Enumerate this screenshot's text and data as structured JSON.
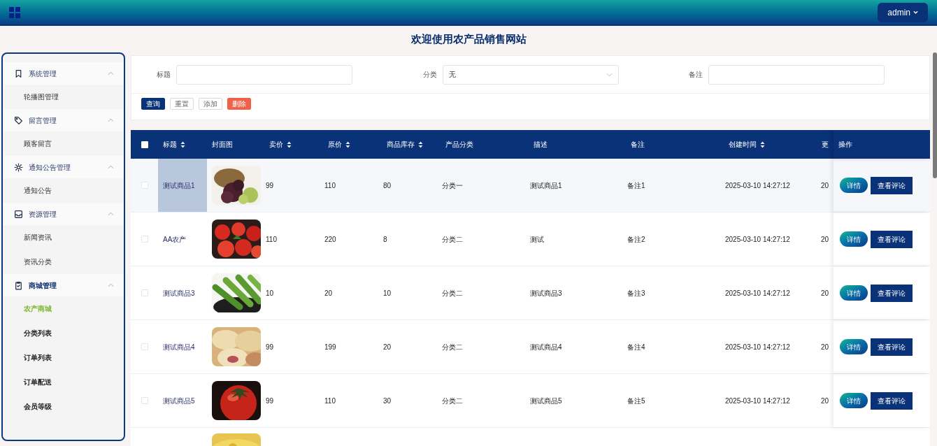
{
  "header": {
    "user_menu": "admin"
  },
  "page_title": "欢迎使用农产品销售网站",
  "sidebar": {
    "groups": [
      {
        "label": "系统管理",
        "expanded": true,
        "active": false,
        "items": [
          {
            "label": "轮播图管理",
            "selected": false
          }
        ]
      },
      {
        "label": "留言管理",
        "expanded": true,
        "active": false,
        "items": [
          {
            "label": "顾客留言",
            "selected": false
          }
        ]
      },
      {
        "label": "通知公告管理",
        "expanded": true,
        "active": false,
        "items": [
          {
            "label": "通知公告",
            "selected": false
          }
        ]
      },
      {
        "label": "资源管理",
        "expanded": true,
        "active": false,
        "items": [
          {
            "label": "新闻资讯",
            "selected": false
          },
          {
            "label": "资讯分类",
            "selected": false
          }
        ]
      },
      {
        "label": "商城管理",
        "expanded": true,
        "active": true,
        "items": [
          {
            "label": "农产商城",
            "selected": true
          },
          {
            "label": "分类列表",
            "selected": false
          },
          {
            "label": "订单列表",
            "selected": false
          },
          {
            "label": "订单配送",
            "selected": false
          },
          {
            "label": "会员等级",
            "selected": false
          }
        ]
      }
    ]
  },
  "search": {
    "fields": [
      {
        "label": "标题",
        "kind": "text"
      },
      {
        "label": "分类",
        "kind": "select",
        "value": "无"
      },
      {
        "label": "备注",
        "kind": "text"
      }
    ],
    "buttons": [
      {
        "label": "查询",
        "kind": "primary"
      },
      {
        "label": "重置",
        "kind": "plain"
      },
      {
        "label": "添加",
        "kind": "plain"
      },
      {
        "label": "删除",
        "kind": "danger"
      }
    ]
  },
  "table": {
    "select_all": {
      "checked": false
    },
    "columns": [
      {
        "label": "标题",
        "sortable": true
      },
      {
        "label": "封面图",
        "sortable": false
      },
      {
        "label": "卖价",
        "sortable": true
      },
      {
        "label": "原价",
        "sortable": true
      },
      {
        "label": "商品库存",
        "sortable": true
      },
      {
        "label": "产品分类",
        "sortable": false
      },
      {
        "label": "描述",
        "sortable": false
      },
      {
        "label": "备注",
        "sortable": false
      },
      {
        "label": "创建时间",
        "sortable": true
      },
      {
        "label": "更",
        "sortable": false
      },
      {
        "label": "操作",
        "sortable": false
      }
    ],
    "rows": [
      {
        "checked": false,
        "hovered": true,
        "title": "测试商品1",
        "cover": {
          "kind": "picture"
        },
        "price": "99",
        "original_price": "110",
        "stock": "80",
        "category": "分类一",
        "description": "测试商品1",
        "note": "备注1",
        "created": "2025-03-10 14:27:12",
        "updated": "20",
        "actions": [
          "详情",
          "查看评论"
        ]
      },
      {
        "checked": false,
        "hovered": false,
        "title": "AA农产",
        "cover": {
          "kind": "picture"
        },
        "price": "110",
        "original_price": "220",
        "stock": "8",
        "category": "分类二",
        "description": "测试",
        "note": "备注2",
        "created": "2025-03-10 14:27:12",
        "updated": "20",
        "actions": [
          "详情",
          "查看评论"
        ]
      },
      {
        "checked": false,
        "hovered": false,
        "title": "测试商品3",
        "cover": {
          "kind": "picture"
        },
        "price": "10",
        "original_price": "20",
        "stock": "10",
        "category": "分类二",
        "description": "测试商品3",
        "note": "备注3",
        "created": "2025-03-10 14:27:12",
        "updated": "20",
        "actions": [
          "详情",
          "查看评论"
        ]
      },
      {
        "checked": false,
        "hovered": false,
        "title": "测试商品4",
        "cover": {
          "kind": "picture"
        },
        "price": "99",
        "original_price": "199",
        "stock": "20",
        "category": "分类二",
        "description": "测试商品4",
        "note": "备注4",
        "created": "2025-03-10 14:27:12",
        "updated": "20",
        "actions": [
          "详情",
          "查看评论"
        ]
      },
      {
        "checked": false,
        "hovered": false,
        "title": "测试商品5",
        "cover": {
          "kind": "picture"
        },
        "price": "99",
        "original_price": "110",
        "stock": "30",
        "category": "分类二",
        "description": "测试商品5",
        "note": "备注5",
        "created": "2025-03-10 14:27:12",
        "updated": "20",
        "actions": [
          "详情",
          "查看评论"
        ]
      }
    ]
  }
}
